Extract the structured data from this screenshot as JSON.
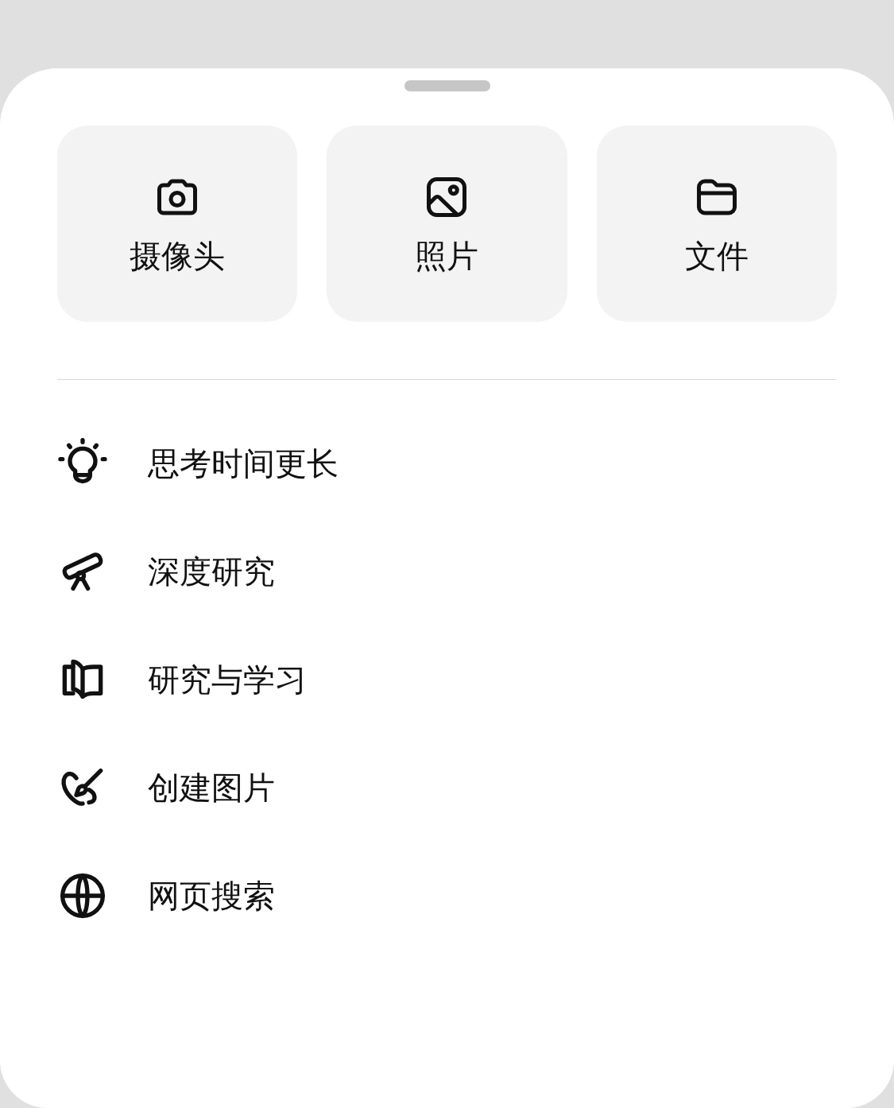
{
  "attachments": [
    {
      "label": "摄像头"
    },
    {
      "label": "照片"
    },
    {
      "label": "文件"
    }
  ],
  "options": [
    {
      "label": "思考时间更长"
    },
    {
      "label": "深度研究"
    },
    {
      "label": "研究与学习"
    },
    {
      "label": "创建图片"
    },
    {
      "label": "网页搜索"
    }
  ]
}
